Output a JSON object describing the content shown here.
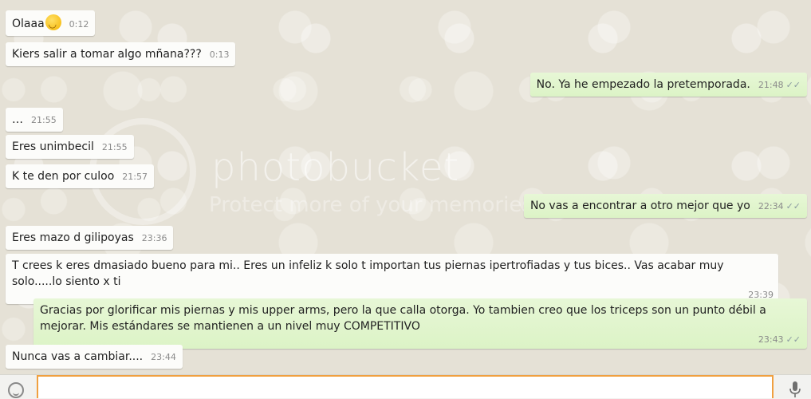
{
  "messages": [
    {
      "direction": "in",
      "text": "Olaaa",
      "emoji": "smiling-face",
      "time": "0:12"
    },
    {
      "direction": "in",
      "text": "Kiers salir a tomar algo mñana???",
      "time": "0:13"
    },
    {
      "direction": "out",
      "text": "No. Ya he empezado la pretemporada.",
      "time": "21:48",
      "ticks": "✓✓"
    },
    {
      "direction": "in",
      "text": "…",
      "time": "21:55"
    },
    {
      "direction": "in",
      "text": "Eres unimbecil",
      "time": "21:55"
    },
    {
      "direction": "in",
      "text": "K te den por culoo",
      "time": "21:57"
    },
    {
      "direction": "out",
      "text": "No vas a encontrar a otro mejor que yo",
      "time": "22:34",
      "ticks": "✓✓"
    },
    {
      "direction": "in",
      "text": "Eres mazo d gilipoyas",
      "time": "23:36"
    },
    {
      "direction": "in",
      "text": "T crees k eres dmasiado bueno para mi.. Eres un infeliz k solo t importan tus piernas ipertrofiadas y tus bices.. Vas acabar muy solo.....lo siento x ti",
      "time": "23:39"
    },
    {
      "direction": "out",
      "text": "Gracias por glorificar mis piernas y mis upper arms, pero la que calla otorga. Yo tambien creo que los triceps son un punto débil a mejorar. Mis estándares se mantienen a un nivel muy COMPETITIVO",
      "time": "23:43",
      "ticks": "✓✓"
    },
    {
      "direction": "in",
      "text": "Nunca vas a cambiar....",
      "time": "23:44"
    }
  ],
  "watermark": {
    "text": "photobucket",
    "subtext": "Protect more of your memories for less!"
  },
  "input": {
    "value": "",
    "placeholder": ""
  },
  "icons": {
    "emoji_button": "smiley-icon",
    "voice_button": "mic-icon"
  },
  "colors": {
    "incoming": "#fcfcfa",
    "outgoing": "#dcf8c6",
    "input_focus": "#f0a040"
  }
}
